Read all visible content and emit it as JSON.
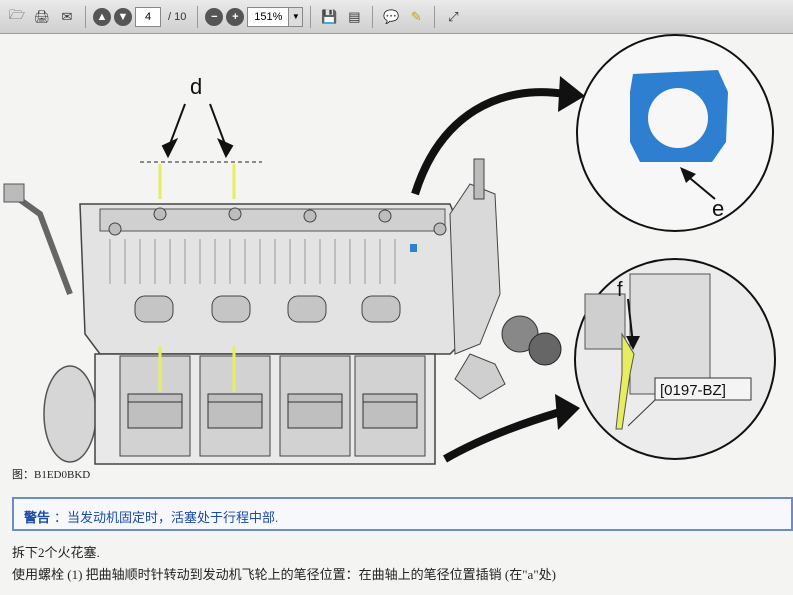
{
  "toolbar": {
    "page_current": "4",
    "page_total": "/ 10",
    "zoom": "151%"
  },
  "figure": {
    "label_d": "d",
    "label_e": "e",
    "label_f": "f",
    "tool_code": "[0197-BZ]",
    "caption": "图：B1ED0BKD"
  },
  "warning": {
    "title": "警告",
    "text": "：当发动机固定时，活塞处于行程中部."
  },
  "steps": {
    "step1": "拆下2个火花塞.",
    "step2": "使用螺栓 (1) 把曲轴顺时针转动到发动机飞轮上的笔径位置：在曲轴上的笔径位置插销 (在\"a\"处)"
  },
  "colors": {
    "ring_blue": "#2f7fd0",
    "warning_blue": "#1a4aa6",
    "marker_yellow": "#e6ee60"
  }
}
